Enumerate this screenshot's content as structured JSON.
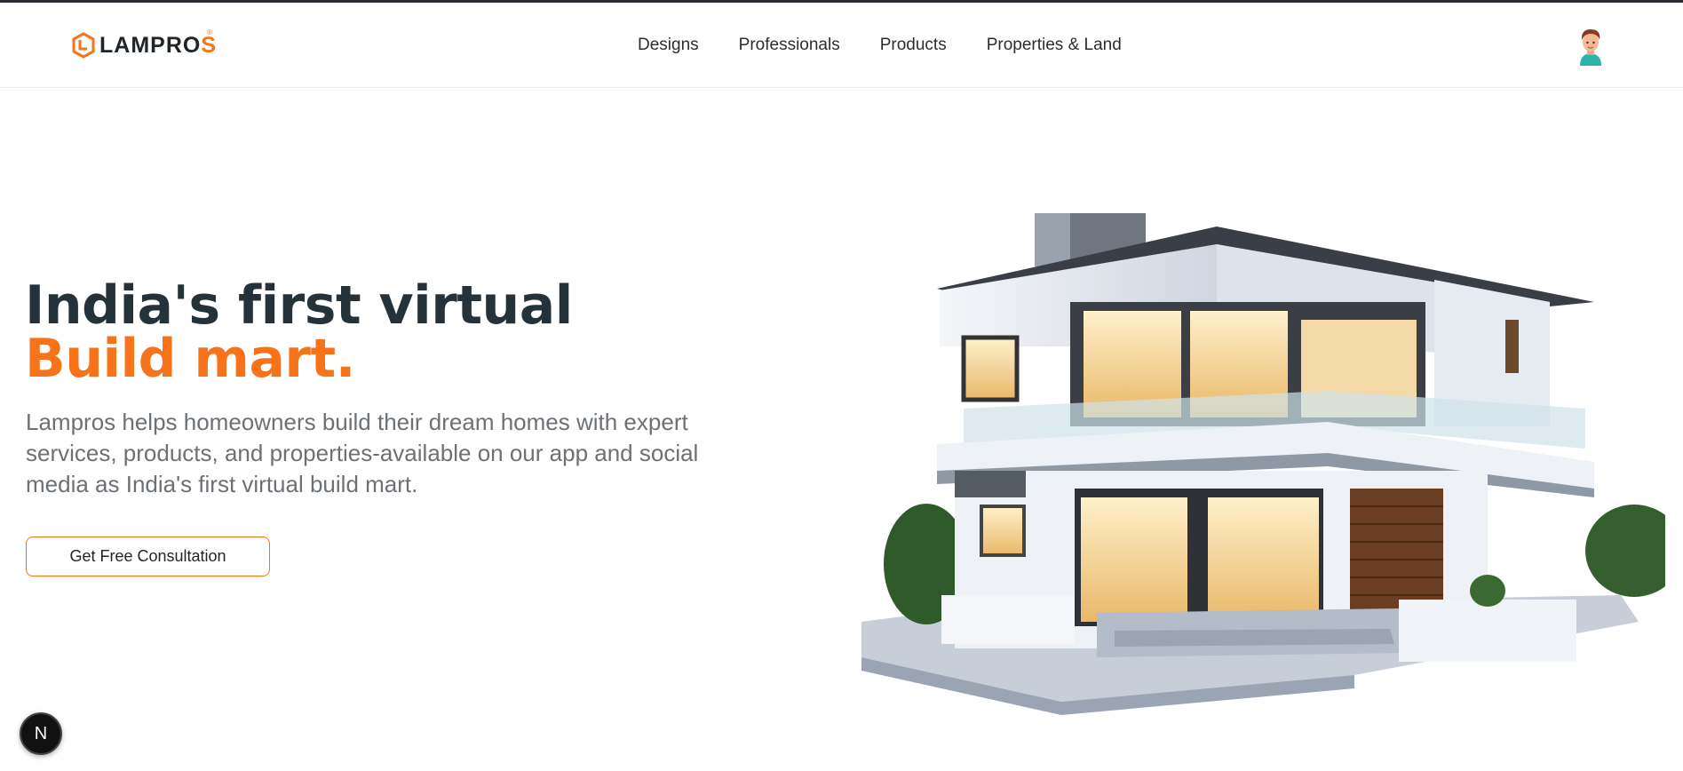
{
  "brand": {
    "name_main": "LAMPRO",
    "name_last": "S",
    "registered_mark": "®",
    "accent_color": "#f7731a",
    "dark_color": "#26323a"
  },
  "nav": {
    "items": [
      {
        "label": "Designs"
      },
      {
        "label": "Professionals"
      },
      {
        "label": "Products"
      },
      {
        "label": "Properties & Land"
      }
    ]
  },
  "hero": {
    "title_line1": "India's first virtual",
    "title_line2": "Build mart.",
    "description": "Lampros helps homeowners build their dream homes with expert services, products, and properties-available on our app and social media as India's first virtual build mart.",
    "cta_label": "Get Free Consultation"
  },
  "devtools": {
    "badge_label": "N"
  },
  "icons": {
    "logo": "hexagon-logo-icon",
    "avatar": "user-avatar-icon",
    "hero_image": "modern-house-illustration"
  }
}
